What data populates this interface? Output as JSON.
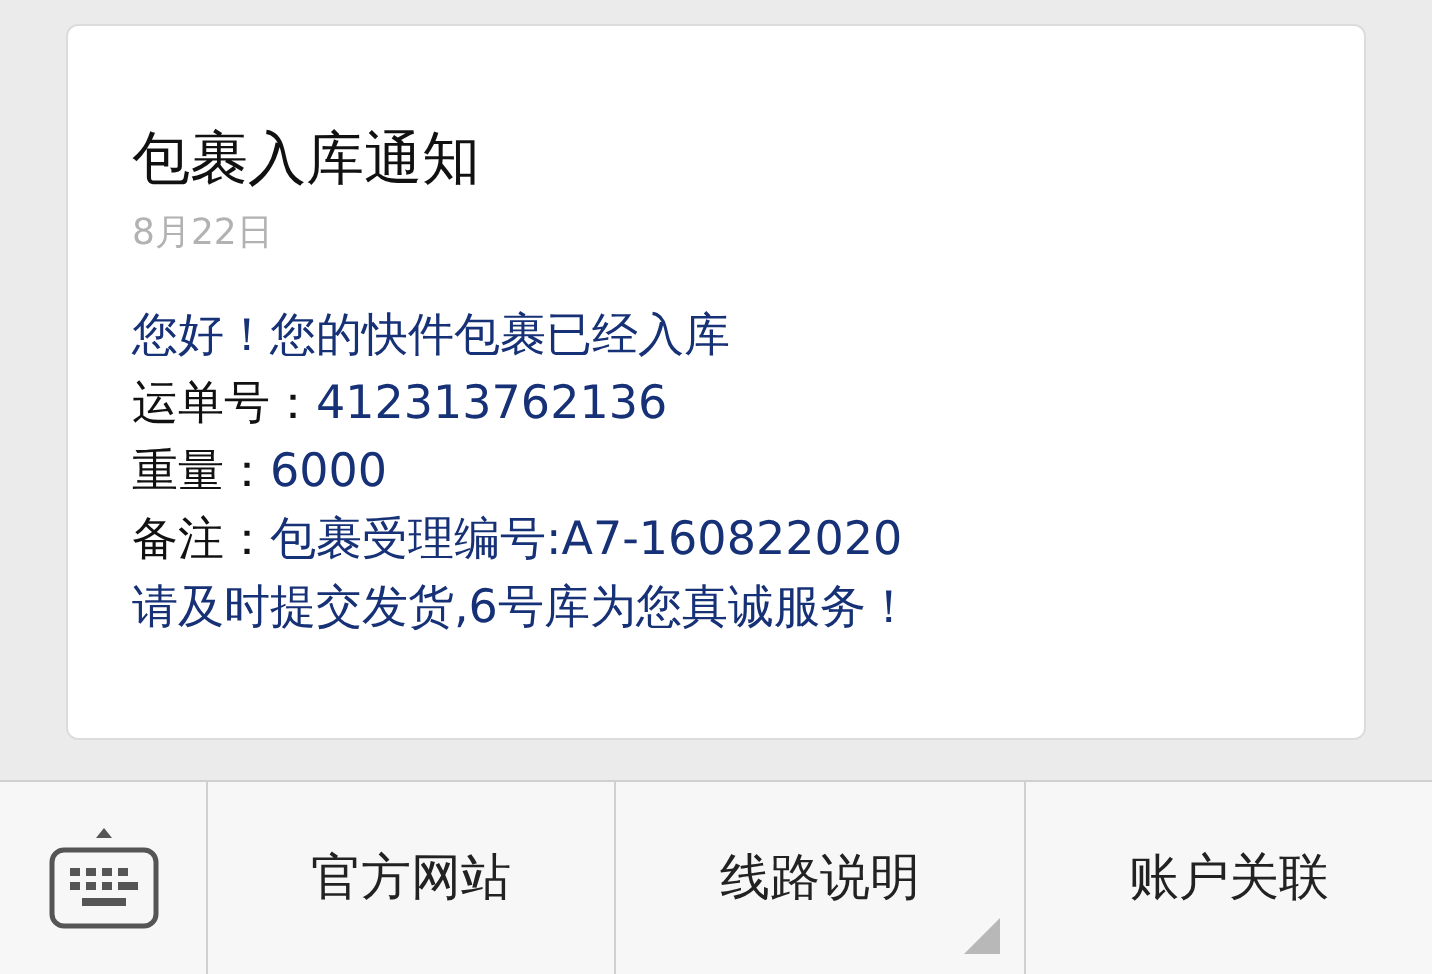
{
  "message": {
    "title": "包裹入库通知",
    "date": "8月22日",
    "lines": [
      {
        "value": "您好！您的快件包裹已经入库"
      },
      {
        "label": "运单号：",
        "value": "412313762136"
      },
      {
        "label": "重量：",
        "value": "6000"
      },
      {
        "label": "备注：",
        "value": "包裹受理编号:A7-160822020"
      },
      {
        "value": "请及时提交发货,6号库为您真诚服务！"
      }
    ]
  },
  "menu": [
    {
      "label": "官方网站",
      "has_submenu": false
    },
    {
      "label": "线路说明",
      "has_submenu": true
    },
    {
      "label": "账户关联",
      "has_submenu": false
    }
  ]
}
